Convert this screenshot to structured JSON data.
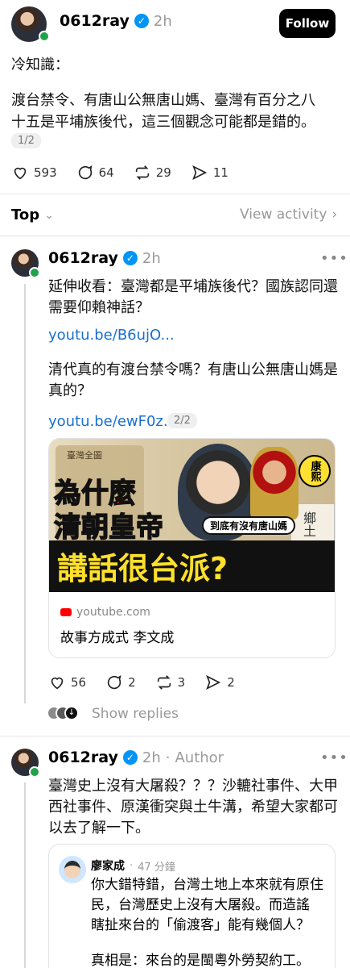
{
  "main_post": {
    "username": "0612ray",
    "time": "2h",
    "follow_label": "Follow",
    "line1": "冷知識：",
    "line2": "渡台禁令、有唐山公無唐山媽、臺灣有百分之八",
    "line3": "十五是平埔族後代，這三個觀念可能都是錯的。",
    "page": "1/2",
    "likes": "593",
    "comments": "64",
    "reposts": "29",
    "shares": "11"
  },
  "sort": {
    "label": "Top",
    "view_activity": "View activity"
  },
  "reply1": {
    "username": "0612ray",
    "time": "2h",
    "para1_l1": "延伸收看：臺灣都是平埔族後代？國族認同還",
    "para1_l2": "需要仰賴神話？",
    "link1": "youtu.be/B6ujO...",
    "para2_l1": "清代真的有渡台禁令嗎？有唐山公無唐山媽是",
    "para2_l2": "真的？",
    "link2": "youtu.be/ewF0z...",
    "page": "2/2",
    "thumb": {
      "line1": "為什麼",
      "line2": "清朝皇帝",
      "line3": "講話很台派?",
      "banner": "到底有沒有唐山媽",
      "badge": "康熙",
      "map_label": "臺灣全圖",
      "paper_text": "鄉土"
    },
    "link_domain": "youtube.com",
    "link_title": "故事方成式 李文成",
    "likes": "56",
    "comments": "2",
    "reposts": "3",
    "shares": "2",
    "show_replies": "Show replies"
  },
  "reply2": {
    "username": "0612ray",
    "time": "2h",
    "author_tag": "Author",
    "line1": "臺灣史上沒有大屠殺？？？沙轆社事件、大甲",
    "line2": "西社事件、原漢衝突與土牛溝，希望大家都可",
    "line3": "以去了解一下。",
    "quote": {
      "name": "廖家成",
      "time": "47 分鐘",
      "l1": "你大錯特錯，台灣土地上本來就有原住",
      "l2": "民，台灣歷史上沒有大屠殺。而造謠",
      "l3": "瞎扯來台的「偷渡客」能有幾個人？",
      "l4": "真相是：來台的是閩粵外勞契約工。"
    }
  },
  "colors": {
    "link": "#1a6fd0",
    "verified": "#0095f6",
    "online": "#1fa34a"
  }
}
